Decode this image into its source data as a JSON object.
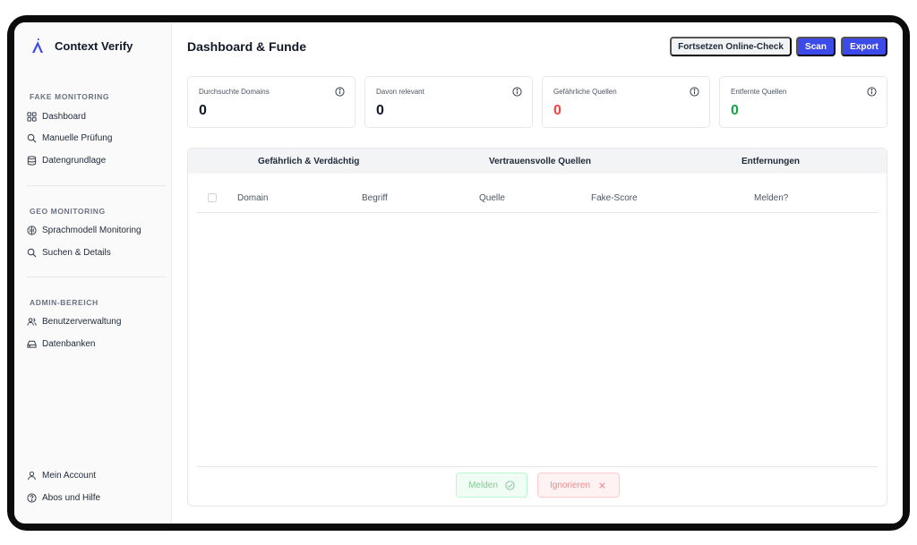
{
  "app": {
    "name": "Context Verify"
  },
  "sidebar": {
    "sections": [
      {
        "label": "FAKE MONITORING",
        "items": [
          "Dashboard",
          "Manuelle Prüfung",
          "Datengrundlage"
        ]
      },
      {
        "label": "GEO MONITORING",
        "items": [
          "Sprachmodell Monitoring",
          "Suchen & Details"
        ]
      },
      {
        "label": "ADMIN-BEREICH",
        "items": [
          "Benutzerverwaltung",
          "Datenbanken"
        ]
      }
    ],
    "footer": [
      "Mein Account",
      "Abos und Hilfe"
    ]
  },
  "header": {
    "title": "Dashboard & Funde",
    "buttons": {
      "continue": "Fortsetzen Online-Check",
      "scan": "Scan",
      "export": "Export"
    }
  },
  "stats": [
    {
      "label": "Durchsuchte Domains",
      "value": "0",
      "color": "#111827"
    },
    {
      "label": "Davon relevant",
      "value": "0",
      "color": "#111827"
    },
    {
      "label": "Gefährliche Quellen",
      "value": "0",
      "color": "#ef4444"
    },
    {
      "label": "Entfernte Quellen",
      "value": "0",
      "color": "#16a34a"
    }
  ],
  "tabs": [
    "Gefährlich & Verdächtig",
    "Vertrauensvolle Quellen",
    "Entfernungen"
  ],
  "table": {
    "columns": [
      "Domain",
      "Begriff",
      "Quelle",
      "Fake-Score",
      "Melden?"
    ]
  },
  "actions": {
    "report": "Melden",
    "ignore": "Ignorieren"
  },
  "colors": {
    "accent": "#3b4ae8",
    "danger": "#ef4444",
    "success": "#16a34a"
  }
}
